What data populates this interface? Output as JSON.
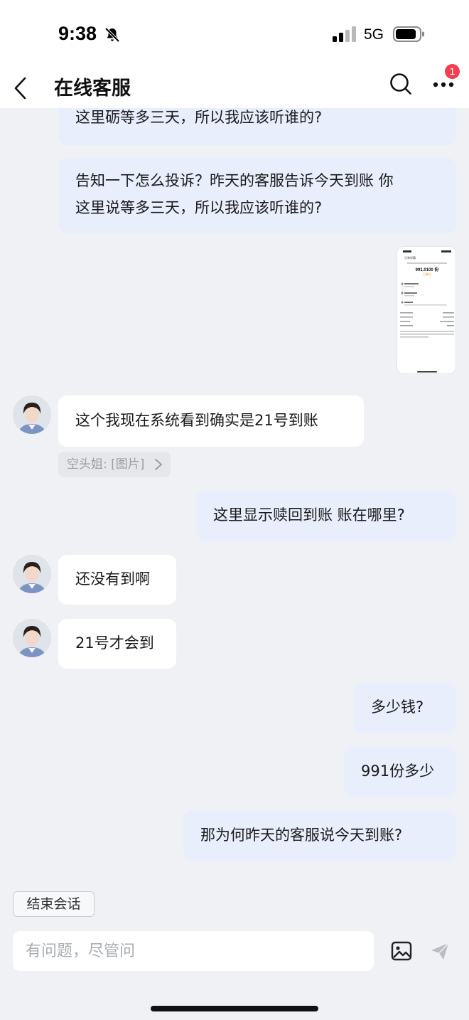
{
  "status_bar": {
    "time": "9:38",
    "network": "5G"
  },
  "header": {
    "title": "在线客服",
    "notification_count": "1"
  },
  "messages": [
    {
      "sender": "user",
      "text": "这里砺等多三天，所以我应该听谁的?"
    },
    {
      "sender": "user",
      "lines": [
        "告知一下怎么投诉？昨天的客服告诉今天到账 你",
        "这里说等多三天，所以我应该听谁的?"
      ]
    },
    {
      "sender": "user",
      "type": "image",
      "thumbnail": {
        "header": "订单详情",
        "amount": "991.0100 份",
        "status": "已确认"
      }
    },
    {
      "sender": "agent",
      "text": "这个我现在系统看到确实是21号到账"
    },
    {
      "sender": "agent",
      "type": "quote",
      "text": "空头姐: [图片]"
    },
    {
      "sender": "user",
      "text": "这里显示赎回到账 账在哪里?"
    },
    {
      "sender": "agent",
      "text": "还没有到啊"
    },
    {
      "sender": "agent",
      "text": "21号才会到"
    },
    {
      "sender": "user",
      "text": "多少钱?"
    },
    {
      "sender": "user",
      "text": "991份多少"
    },
    {
      "sender": "user",
      "text": "那为何昨天的客服说今天到账?"
    }
  ],
  "footer": {
    "end_chat_label": "结束会话",
    "input_placeholder": "有问题，尽管问"
  },
  "colors": {
    "user_bubble": "#e8eefc",
    "agent_bubble": "#ffffff",
    "background": "#f0f1f5",
    "badge": "#f23f51"
  },
  "icons": [
    "bell-muted-icon",
    "signal-icon",
    "battery-icon",
    "back-icon",
    "search-icon",
    "more-icon",
    "chevron-right-icon",
    "image-upload-icon",
    "send-icon"
  ]
}
